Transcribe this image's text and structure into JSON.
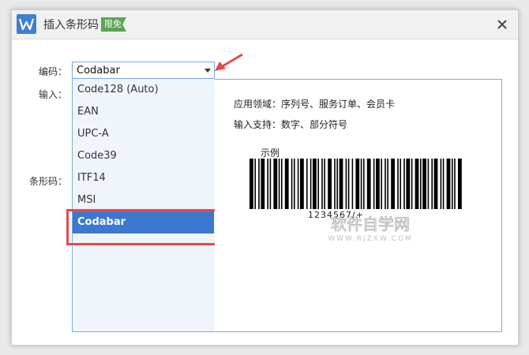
{
  "titlebar": {
    "title": "插入条形码",
    "badge": "限免"
  },
  "form": {
    "encoding_label": "编码：",
    "input_label": "输入：",
    "barcode_label": "条形码："
  },
  "select": {
    "value": "Codabar"
  },
  "options": [
    {
      "label": "Code128 (Auto)"
    },
    {
      "label": "EAN"
    },
    {
      "label": "UPC-A"
    },
    {
      "label": "Code39"
    },
    {
      "label": "ITF14"
    },
    {
      "label": "MSI"
    },
    {
      "label": "Codabar",
      "selected": true
    }
  ],
  "preview": {
    "usage": "应用领域：序列号、服务订单、会员卡",
    "support": "输入支持：数字、部分符号",
    "example_label": "示例",
    "barcode_text": "1234567/+"
  },
  "watermark": {
    "text": "软件自学网",
    "url": "WWW.RJZXW.COM"
  },
  "colors": {
    "accent": "#3d78d0",
    "highlight": "#e44a4a",
    "badge": "#5aa552"
  },
  "icons": {
    "logo": "wps-writer-icon",
    "close": "close-icon",
    "dropdown": "chevron-down-icon"
  }
}
